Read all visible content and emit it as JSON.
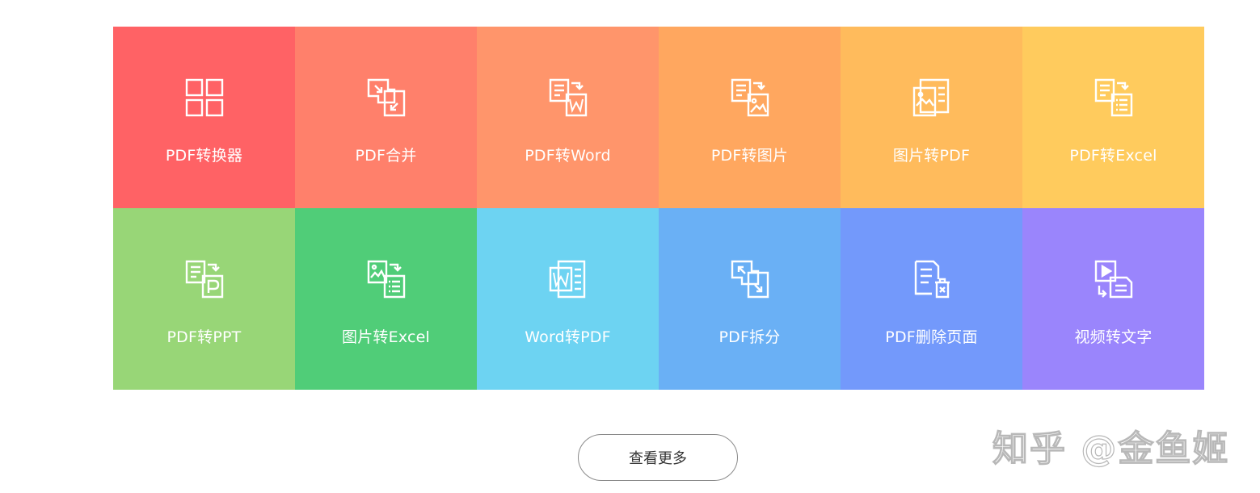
{
  "tools": [
    {
      "label": "PDF转换器",
      "icon": "grid-icon",
      "color": "#ff6265"
    },
    {
      "label": "PDF合并",
      "icon": "merge-icon",
      "color": "#ff806b"
    },
    {
      "label": "PDF转Word",
      "icon": "pdf-to-word-icon",
      "color": "#ff956b"
    },
    {
      "label": "PDF转图片",
      "icon": "pdf-to-image-icon",
      "color": "#ffa75f"
    },
    {
      "label": "图片转PDF",
      "icon": "image-to-pdf-icon",
      "color": "#ffbb5c"
    },
    {
      "label": "PDF转Excel",
      "icon": "pdf-to-excel-icon",
      "color": "#ffcb5d"
    },
    {
      "label": "PDF转PPT",
      "icon": "pdf-to-ppt-icon",
      "color": "#98d677"
    },
    {
      "label": "图片转Excel",
      "icon": "image-to-excel-icon",
      "color": "#50cd78"
    },
    {
      "label": "Word转PDF",
      "icon": "word-to-pdf-icon",
      "color": "#6dd3f2"
    },
    {
      "label": "PDF拆分",
      "icon": "split-icon",
      "color": "#6ab0f5"
    },
    {
      "label": "PDF删除页面",
      "icon": "delete-page-icon",
      "color": "#7399fb"
    },
    {
      "label": "视频转文字",
      "icon": "video-to-text-icon",
      "color": "#9a85fc"
    }
  ],
  "more_button": {
    "label": "查看更多"
  },
  "watermark": {
    "text": "知乎 @金鱼姬"
  }
}
